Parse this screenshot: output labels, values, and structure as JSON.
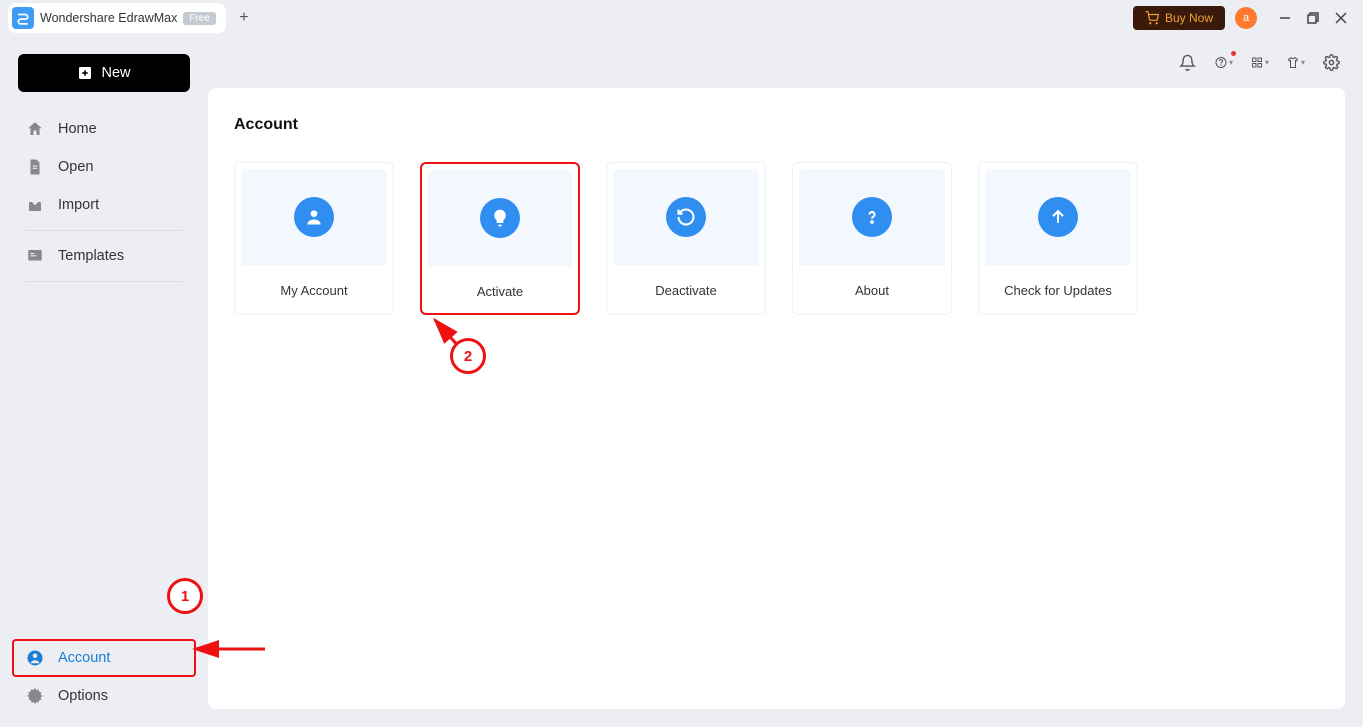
{
  "titlebar": {
    "app_name": "Wondershare EdrawMax",
    "badge": "Free",
    "buy_now": "Buy Now",
    "avatar_letter": "a"
  },
  "sidebar": {
    "new_label": "New",
    "items": [
      {
        "label": "Home"
      },
      {
        "label": "Open"
      },
      {
        "label": "Import"
      },
      {
        "label": "Templates"
      }
    ],
    "bottom": [
      {
        "label": "Account"
      },
      {
        "label": "Options"
      }
    ]
  },
  "panel": {
    "title": "Account",
    "cards": [
      {
        "label": "My Account"
      },
      {
        "label": "Activate"
      },
      {
        "label": "Deactivate"
      },
      {
        "label": "About"
      },
      {
        "label": "Check for Updates"
      }
    ]
  },
  "annotations": {
    "step1": "1",
    "step2": "2"
  }
}
